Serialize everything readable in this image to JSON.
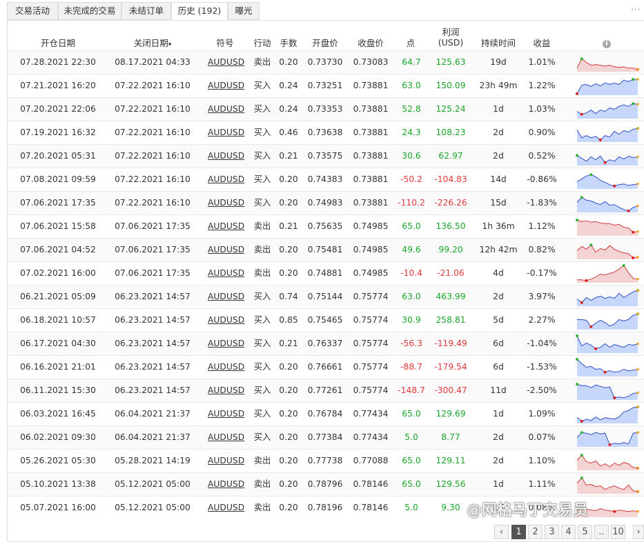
{
  "tabs": [
    {
      "label": "交易活动",
      "active": false
    },
    {
      "label": "未完成的交易",
      "active": false
    },
    {
      "label": "未结订单",
      "active": false
    },
    {
      "label": "历史 (192)",
      "active": true
    },
    {
      "label": "曝光",
      "active": false
    }
  ],
  "columns": {
    "open_date": "开仓日期",
    "close_date": "关闭日期",
    "sort_indicator": "▾",
    "symbol": "符号",
    "action": "行动",
    "lots": "手数",
    "open_price": "开盘价",
    "close_price": "收盘价",
    "points": "点",
    "profit": "利润",
    "profit_unit": "(USD)",
    "duration": "持续时间",
    "gain": "收益",
    "info_icon": "info-icon"
  },
  "rows": [
    {
      "open": "07.28.2021 22:30",
      "close": "08.17.2021 04:33",
      "symbol": "AUDUSD",
      "action": "卖出",
      "lots": "0.20",
      "open_price": "0.73730",
      "close_price": "0.73083",
      "points": "64.7",
      "profit": "125.63",
      "duration": "19d",
      "gain": "1.01%",
      "trend": [
        5,
        18,
        13,
        9,
        10,
        9,
        8,
        9,
        7,
        6,
        7,
        5,
        5,
        3
      ],
      "spark": "red"
    },
    {
      "open": "07.21.2021 16:20",
      "close": "07.22.2021 16:10",
      "symbol": "AUDUSD",
      "action": "买入",
      "lots": "0.24",
      "open_price": "0.73251",
      "close_price": "0.73881",
      "points": "63.0",
      "profit": "150.09",
      "duration": "23h 49m",
      "gain": "1.22%",
      "trend": [
        2,
        14,
        15,
        12,
        16,
        13,
        17,
        15,
        17,
        15,
        21,
        19,
        22,
        22
      ],
      "spark": "blue"
    },
    {
      "open": "07.20.2021 22:06",
      "close": "07.22.2021 16:10",
      "symbol": "AUDUSD",
      "action": "买入",
      "lots": "0.24",
      "open_price": "0.73353",
      "close_price": "0.73881",
      "points": "52.8",
      "profit": "125.24",
      "duration": "1d",
      "gain": "1.03%",
      "trend": [
        10,
        6,
        8,
        12,
        7,
        12,
        10,
        15,
        13,
        17,
        19,
        17,
        21,
        20
      ],
      "spark": "blue"
    },
    {
      "open": "07.19.2021 16:32",
      "close": "07.22.2021 16:10",
      "symbol": "AUDUSD",
      "action": "买入",
      "lots": "0.46",
      "open_price": "0.73638",
      "close_price": "0.73881",
      "points": "24.3",
      "profit": "108.23",
      "duration": "2d",
      "gain": "0.90%",
      "trend": [
        17,
        6,
        9,
        6,
        8,
        3,
        9,
        7,
        15,
        11,
        16,
        14,
        18,
        19
      ],
      "spark": "blue"
    },
    {
      "open": "07.20.2021 05:31",
      "close": "07.22.2021 16:10",
      "symbol": "AUDUSD",
      "action": "买入",
      "lots": "0.21",
      "open_price": "0.73575",
      "close_price": "0.73881",
      "points": "30.6",
      "profit": "62.97",
      "duration": "2d",
      "gain": "0.52%",
      "trend": [
        14,
        10,
        6,
        12,
        8,
        13,
        4,
        8,
        6,
        12,
        9,
        13,
        11,
        12
      ],
      "spark": "blue"
    },
    {
      "open": "07.08.2021 09:59",
      "close": "07.22.2021 16:10",
      "symbol": "AUDUSD",
      "action": "买入",
      "lots": "0.20",
      "open_price": "0.74383",
      "close_price": "0.73881",
      "points": "-50.2",
      "profit": "-104.83",
      "duration": "14d",
      "gain": "-0.86%",
      "trend": [
        10,
        14,
        18,
        20,
        17,
        12,
        9,
        6,
        4,
        6,
        7,
        5,
        6,
        7
      ],
      "spark": "blue"
    },
    {
      "open": "07.06.2021 17:35",
      "close": "07.22.2021 16:10",
      "symbol": "AUDUSD",
      "action": "买入",
      "lots": "0.20",
      "open_price": "0.74983",
      "close_price": "0.73881",
      "points": "-110.2",
      "profit": "-226.26",
      "duration": "15d",
      "gain": "-1.83%",
      "trend": [
        14,
        21,
        17,
        16,
        13,
        11,
        15,
        10,
        11,
        7,
        4,
        2,
        7,
        9
      ],
      "spark": "blue"
    },
    {
      "open": "07.06.2021 15:58",
      "close": "07.06.2021 17:35",
      "symbol": "AUDUSD",
      "action": "卖出",
      "lots": "0.21",
      "open_price": "0.75635",
      "close_price": "0.74985",
      "points": "65.0",
      "profit": "136.50",
      "duration": "1h 36m",
      "gain": "1.12%",
      "trend": [
        22,
        20,
        21,
        19,
        20,
        18,
        17,
        17,
        15,
        16,
        12,
        11,
        5,
        6
      ],
      "spark": "red"
    },
    {
      "open": "07.06.2021 04:52",
      "close": "07.06.2021 17:35",
      "symbol": "AUDUSD",
      "action": "卖出",
      "lots": "0.20",
      "open_price": "0.75481",
      "close_price": "0.74985",
      "points": "49.6",
      "profit": "99.20",
      "duration": "12h 42m",
      "gain": "0.82%",
      "trend": [
        12,
        18,
        14,
        20,
        10,
        15,
        13,
        19,
        14,
        11,
        9,
        8,
        2,
        3
      ],
      "spark": "red"
    },
    {
      "open": "07.02.2021 16:00",
      "close": "07.06.2021 17:35",
      "symbol": "AUDUSD",
      "action": "卖出",
      "lots": "0.20",
      "open_price": "0.74881",
      "close_price": "0.74985",
      "points": "-10.4",
      "profit": "-21.06",
      "duration": "4d",
      "gain": "-0.17%",
      "trend": [
        4,
        4,
        3,
        5,
        8,
        12,
        11,
        13,
        15,
        19,
        24,
        14,
        6,
        5
      ],
      "spark": "red"
    },
    {
      "open": "06.21.2021 05:09",
      "close": "06.23.2021 14:57",
      "symbol": "AUDUSD",
      "action": "买入",
      "lots": "0.74",
      "open_price": "0.75144",
      "close_price": "0.75774",
      "points": "63.0",
      "profit": "463.99",
      "duration": "2d",
      "gain": "3.97%",
      "trend": [
        10,
        5,
        12,
        8,
        12,
        14,
        11,
        13,
        11,
        18,
        12,
        16,
        20,
        22
      ],
      "spark": "blue"
    },
    {
      "open": "06.18.2021 10:57",
      "close": "06.23.2021 14:57",
      "symbol": "AUDUSD",
      "action": "买入",
      "lots": "0.85",
      "open_price": "0.75465",
      "close_price": "0.75774",
      "points": "30.9",
      "profit": "258.81",
      "duration": "5d",
      "gain": "2.27%",
      "trend": [
        14,
        14,
        13,
        4,
        9,
        13,
        10,
        5,
        8,
        14,
        12,
        14,
        20,
        22
      ],
      "spark": "blue"
    },
    {
      "open": "06.17.2021 04:30",
      "close": "06.23.2021 14:57",
      "symbol": "AUDUSD",
      "action": "买入",
      "lots": "0.21",
      "open_price": "0.76337",
      "close_price": "0.75774",
      "points": "-56.3",
      "profit": "-119.49",
      "duration": "6d",
      "gain": "-1.04%",
      "trend": [
        24,
        10,
        14,
        11,
        6,
        8,
        13,
        8,
        12,
        10,
        8,
        12,
        11,
        13
      ],
      "spark": "blue"
    },
    {
      "open": "06.16.2021 21:01",
      "close": "06.23.2021 14:57",
      "symbol": "AUDUSD",
      "action": "买入",
      "lots": "0.20",
      "open_price": "0.76661",
      "close_price": "0.75774",
      "points": "-88.7",
      "profit": "-179.54",
      "duration": "6d",
      "gain": "-1.53%",
      "trend": [
        24,
        18,
        13,
        14,
        10,
        11,
        6,
        8,
        6,
        7,
        10,
        8,
        9,
        10
      ],
      "spark": "blue"
    },
    {
      "open": "06.11.2021 15:30",
      "close": "06.23.2021 14:57",
      "symbol": "AUDUSD",
      "action": "买入",
      "lots": "0.20",
      "open_price": "0.77261",
      "close_price": "0.75774",
      "points": "-148.7",
      "profit": "-300.47",
      "duration": "11d",
      "gain": "-2.50%",
      "trend": [
        22,
        20,
        20,
        17,
        21,
        19,
        17,
        18,
        3,
        4,
        3,
        5,
        9,
        10
      ],
      "spark": "blue"
    },
    {
      "open": "06.03.2021 16:45",
      "close": "06.04.2021 21:37",
      "symbol": "AUDUSD",
      "action": "买入",
      "lots": "0.20",
      "open_price": "0.76784",
      "close_price": "0.77434",
      "points": "65.0",
      "profit": "129.69",
      "duration": "1d",
      "gain": "1.09%",
      "trend": [
        8,
        3,
        6,
        4,
        9,
        5,
        8,
        7,
        6,
        9,
        16,
        18,
        22,
        23
      ],
      "spark": "blue"
    },
    {
      "open": "06.02.2021 09:30",
      "close": "06.04.2021 21:37",
      "symbol": "AUDUSD",
      "action": "买入",
      "lots": "0.20",
      "open_price": "0.77384",
      "close_price": "0.77434",
      "points": "5.0",
      "profit": "8.77",
      "duration": "2d",
      "gain": "0.07%",
      "trend": [
        13,
        20,
        19,
        17,
        20,
        18,
        19,
        3,
        5,
        4,
        6,
        4,
        19,
        20
      ],
      "spark": "blue"
    },
    {
      "open": "05.26.2021 05:30",
      "close": "05.28.2021 14:19",
      "symbol": "AUDUSD",
      "action": "卖出",
      "lots": "0.20",
      "open_price": "0.77738",
      "close_price": "0.77088",
      "points": "65.0",
      "profit": "129.11",
      "duration": "2d",
      "gain": "1.10%",
      "trend": [
        14,
        21,
        12,
        10,
        13,
        6,
        9,
        5,
        10,
        7,
        11,
        9,
        4,
        3
      ],
      "spark": "red"
    },
    {
      "open": "05.10.2021 13:38",
      "close": "05.12.2021 05:00",
      "symbol": "AUDUSD",
      "action": "卖出",
      "lots": "0.20",
      "open_price": "0.78796",
      "close_price": "0.78146",
      "points": "65.0",
      "profit": "129.56",
      "duration": "1d",
      "gain": "1.11%",
      "trend": [
        15,
        22,
        12,
        13,
        10,
        11,
        6,
        9,
        11,
        8,
        6,
        12,
        4,
        3
      ],
      "spark": "red"
    },
    {
      "open": "05.07.2021 16:00",
      "close": "05.12.2021 05:00",
      "symbol": "AUDUSD",
      "action": "卖出",
      "lots": "0.20",
      "open_price": "0.78196",
      "close_price": "0.78146",
      "points": "5.0",
      "profit": "9.30",
      "duration": "1d",
      "gain": "0.08%",
      "trend": [
        10,
        12,
        11,
        10,
        9,
        12,
        10,
        9,
        8,
        10,
        9,
        8,
        9,
        8
      ],
      "spark": "red"
    }
  ],
  "pagination": {
    "prev": "‹",
    "pages": [
      "1",
      "2",
      "3",
      "4",
      "5",
      "..",
      "10"
    ],
    "current": "1",
    "next": "›"
  },
  "watermark": "@网格马丁交易员",
  "colors": {
    "positive": "#1aa52a",
    "negative": "#e03a3a",
    "spark_blue_line": "#2f4fc9",
    "spark_blue_fill": "#c7d6fb",
    "spark_red_line": "#d23a3a",
    "spark_red_fill": "#f3d3d3",
    "marker_high": "#2fb52f",
    "marker_low": "#e02020"
  }
}
